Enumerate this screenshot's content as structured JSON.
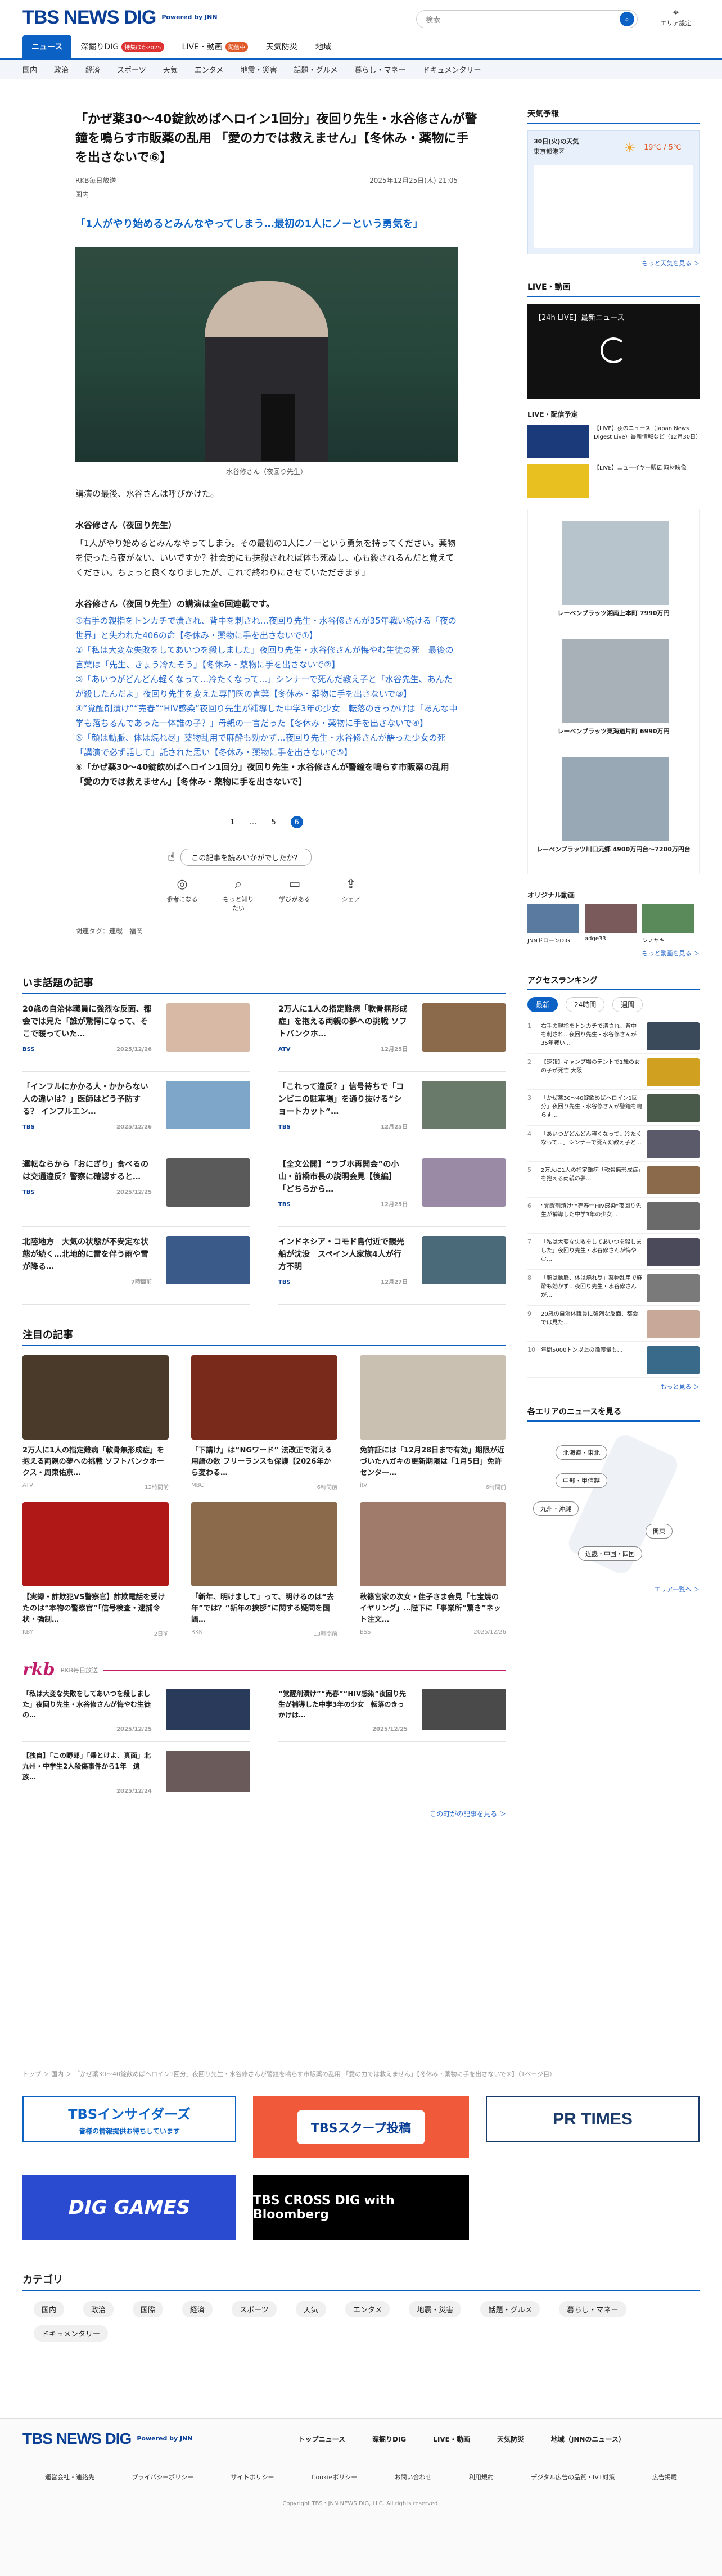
{
  "header": {
    "logo": "TBS NEWS DIG",
    "powered": "Powered by JNN",
    "search_placeholder": "検索",
    "area_label": "エリア設定"
  },
  "nav": [
    {
      "label": "ニュース",
      "on": true
    },
    {
      "label": "深掘りDIG",
      "badge": "特集ほか2025",
      "badge_color": "r"
    },
    {
      "label": "LIVE・動画",
      "badge": "配信中"
    },
    {
      "label": "天気防災"
    },
    {
      "label": "地域"
    }
  ],
  "subnav": [
    "国内",
    "政治",
    "経済",
    "スポーツ",
    "天気",
    "エンタメ",
    "地震・災害",
    "話題・グルメ",
    "暮らし・マネー",
    "ドキュメンタリー"
  ],
  "article": {
    "title": "「かぜ薬30〜40錠飲めばヘロイン1回分」夜回り先生・水谷修さんが警鐘を鳴らす市販薬の乱用 「愛の力では救えません」【冬休み・薬物に手を出さないで⑥】",
    "source": "RKB毎日放送",
    "date": "2025年12月25日(木) 21:05",
    "category": "国内",
    "lead": "「1人がやり始めるとみんなやってしまう…最初の1人にノーという勇気を」",
    "caption": "水谷修さん（夜回り先生）",
    "p1": "講演の最後、水谷さんは呼びかけた。",
    "p2h": "水谷修さん（夜回り先生）",
    "p2": "「1人がやり始めるとみんなやってしまう。その最初の1人にノーという勇気を持ってください。薬物を使ったら夜がない、いいですか？社会的にも抹殺されれば体も死ぬし、心も殺されるんだと覚えてください。ちょっと良くなりましたが、これで終わりにさせていただきます」",
    "series_h": "水谷修さん（夜回り先生）の講演は全6回連載です。",
    "series": [
      "①右手の親指をトンカチで潰され、背中を刺され…夜回り先生・水谷修さんが35年戦い続ける「夜の世界」と失われた406の命【冬休み・薬物に手を出さないで①】",
      "②「私は大変な失敗をしてあいつを殺しました」夜回り先生・水谷修さんが悔やむ生徒の死　最後の言葉は「先生、きょう冷たそう」【冬休み・薬物に手を出さないで②】",
      "③「あいつがどんどん軽くなって…冷たくなって…」シンナーで死んだ教え子と「水谷先生、あんたが殺したんだよ」夜回り先生を変えた専門医の言葉【冬休み・薬物に手を出さないで③】",
      "④“覚醒剤漬け”“売春”“HIV感染”夜回り先生が補導した中学3年の少女　転落のきっかけは「あんな中学も落ちるんであった一体誰の子？」母親の一言だった【冬休み・薬物に手を出さないで④】",
      "⑤「顔は動脈、体は焼れ尽」薬物乱用で麻酔も効かず…夜回り先生・水谷修さんが語った少女の死　「講演で必ず話して」託された思い【冬休み・薬物に手を出さないで⑤】",
      "⑥「かぜ薬30〜40錠飲めばヘロイン1回分」夜回り先生・水谷修さんが警鐘を鳴らす市販薬の乱用　「愛の力では救えません」【冬休み・薬物に手を出さないで】"
    ],
    "pages": [
      "1",
      "…",
      "5",
      "6"
    ],
    "survey": "この記事を読みいかがでしたか？",
    "reactions": [
      "参考になる",
      "もっと知りたい",
      "学びがある",
      "シェア"
    ],
    "tags": "関連タグ：連載　福岡"
  },
  "trending": {
    "title": "いま話題の記事",
    "items": [
      {
        "t": "20歳の自治体職員に強烈な反面、都会では見た「誰が驚愕になって、そこで暖っていた…",
        "s": "BSS",
        "d": "2025/12/26"
      },
      {
        "t": "2万人に1人の指定難病「軟骨無形成症」を抱える両親の夢への挑戦 ソフトバンクホ…",
        "s": "ATV",
        "d": "12月25日"
      },
      {
        "t": "「インフルにかかる人・かからない人の違いは？」医師はどう予防する？ インフルエン…",
        "s": "TBS",
        "d": "2025/12/26"
      },
      {
        "t": "「これって違反？」信号待ちで「コンビニの駐車場」を通り抜ける“ショートカット”…",
        "s": "TBS",
        "d": "12月25日"
      },
      {
        "t": "運転ならから「おにぎり」食べるのは交通違反？警察に確認すると…",
        "s": "TBS",
        "d": "2025/12/25"
      },
      {
        "t": "【全文公開】“ラブホ再開会”の小山・前橋市長の説明会見【後編】「どちらから…",
        "s": "TBS",
        "d": "12月25日"
      },
      {
        "t": "北陸地方　大気の状態が不安定な状態が続く…北地的に雷を伴う雨や雪が降る…",
        "s": "",
        "d": "7時間前"
      },
      {
        "t": "インドネシア・コモド島付近で観光船が沈没　スペイン人家族4人が行方不明",
        "s": "TBS",
        "d": "12月27日"
      }
    ]
  },
  "featured": {
    "title": "注目の記事",
    "items": [
      {
        "t": "2万人に1人の指定難病「軟骨無形成症」を抱える両親の夢への挑戦 ソフトバンクホークス・周東佑京…",
        "s": "ATV",
        "d": "12時間前",
        "c": "#4a3a2a"
      },
      {
        "t": "「下請け」は“NGワード” 法改正で消える用語の数 フリーランスも保護【2026年から変わる…",
        "s": "MBC",
        "d": "6時間前",
        "c": "#7a2a1a"
      },
      {
        "t": "免許証には「12月28日まで有効」期限が近づいたハガキの更新期限は「1月5日」免許センター…",
        "s": "itv",
        "d": "6時間前",
        "c": "#c9c0b2"
      },
      {
        "t": "【実録・詐欺犯VS警察官】詐欺電話を受けたのは“本物の警察官”「信号検査・逮捕令状・強制…",
        "s": "KBY",
        "d": "2日前",
        "c": "#b01818"
      },
      {
        "t": "「新年、明けまして」って、明けるのは“去年”では？“新年の挨拶”に関する疑問を国語…",
        "s": "RKK",
        "d": "13時間前",
        "c": "#8a6a4a"
      },
      {
        "t": "秋篠宮家の次女・佳子さま会見「七宝焼のイヤリング」…陛下に「事業所”驚き”ネット注文…",
        "s": "BSS",
        "d": "2025/12/26",
        "c": "#a07a6a"
      }
    ]
  },
  "rkb": {
    "logo": "rkb",
    "name": "RKB毎日放送",
    "items": [
      {
        "t": "「私は大変な失敗をしてあいつを殺しました」夜回り先生・水谷修さんが悔やむ生徒の…",
        "d": "2025/12/25"
      },
      {
        "t": "“覚醒剤漬け”“売春”“HIV感染”夜回り先生が補導した中学3年の少女　転落のきっかけは…",
        "d": "2025/12/25"
      },
      {
        "t": "【独自】「この野郎」「乗とけよ、真面」北九州・中学生2人殺傷事件から1年　遺族…",
        "d": "2025/12/24"
      }
    ],
    "more": "この町がの記事を見る ＞"
  },
  "breadcrumb": "トップ ＞ 国内 ＞ 「かぜ薬30〜40錠飲めばヘロイン1回分」夜回り先生・水谷修さんが警鐘を鳴らす市販薬の乱用 「愛の力では救えません」【冬休み・薬物に手を出さないで⑥】（1ページ目）",
  "banners": [
    "TBSインサイダーズ",
    "皆様の情報提供お待ちしています",
    "TBSスクープ投稿",
    "PR TIMES",
    "DIG GAMES",
    "TBS CROSS DIG with Bloomberg"
  ],
  "categories": {
    "title": "カテゴリ",
    "items": [
      "国内",
      "政治",
      "国際",
      "経済",
      "スポーツ",
      "天気",
      "エンタメ",
      "地震・災害",
      "話題・グルメ",
      "暮らし・マネー",
      "ドキュメンタリー"
    ]
  },
  "footer": {
    "links": [
      "トップニュース",
      "深掘りDIG",
      "LIVE・動画",
      "天気防災",
      "地域（JNNのニュース）"
    ],
    "sub": [
      "運営会社・連絡先",
      "プライバシーポリシー",
      "サイトポリシー",
      "Cookieポリシー",
      "お問い合わせ",
      "利用規約",
      "デジタル広告の品質・IVT対策",
      "広告掲載"
    ],
    "copy": "Copyright TBS・JNN NEWS DIG, LLC. All rights reserved."
  },
  "sidebar": {
    "weather": {
      "title": "天気予報",
      "date": "30日(火)の天気",
      "place": "東京都港区",
      "temp": "19℃ / 5℃",
      "more": "もっと天気を見る ＞"
    },
    "live": {
      "title": "LIVE・動画",
      "video": "【24h LIVE】最新ニュース",
      "sub": "LIVE・配信予定",
      "items": [
        "【LIVE】夜のニュース（Japan News Digest Live）最新情報など（12月30日）",
        "【LIVE】ニューイヤー駅伝 取材映像"
      ],
      "more": "もっと動画を見る ＞"
    },
    "ads": [
      "レーベンプラッツ湘南上本町 7990万円",
      "レーベンプラッツ東海道片町 6990万円",
      "レーベンプラッツ川口元郷 4900万円台〜7200万円台"
    ],
    "original": {
      "title": "オリジナル動画",
      "items": [
        "JNNドローンDIG",
        "adge33",
        "シノヤキ"
      ]
    },
    "ranking": {
      "title": "アクセスランキング",
      "tabs": [
        "最新",
        "24時間",
        "週間"
      ],
      "items": [
        "右手の親指をトンカチで潰され、背中を刺され…夜回り先生・水谷修さんが35年戦い…",
        "【速報】キャンプ場のテントで1歳の女の子が死亡 大阪",
        "「かぜ薬30〜40錠飲めばヘロイン1回分」夜回り先生・水谷修さんが警鐘を鳴らす…",
        "「あいつがどんどん軽くなって…冷たくなって…」シンナーで死んだ教え子と…",
        "2万人に1人の指定難病「軟骨無形成症」を抱える両親の夢…",
        "“覚醒剤漬け”“売春”“HIV感染”夜回り先生が補導した中学3年の少女…",
        "「私は大変な失敗をしてあいつを殺しました」夜回り先生・水谷修さんが悔やむ…",
        "「顔は動脈、体は焼れ尽」薬物乱用で麻酔も効かず…夜回り先生・水谷修さんが…",
        "20歳の自治体職員に強烈な反面、都会では見た…",
        "年間5000トン以上の漁獲量も…"
      ],
      "more": "もっと見る ＞"
    },
    "areas": {
      "title": "各エリアのニュースを見る",
      "btns": [
        "北海道・東北",
        "中部・甲信越",
        "九州・沖縄",
        "関東",
        "近畿・中国・四国"
      ],
      "more": "エリア一覧へ ＞"
    }
  }
}
